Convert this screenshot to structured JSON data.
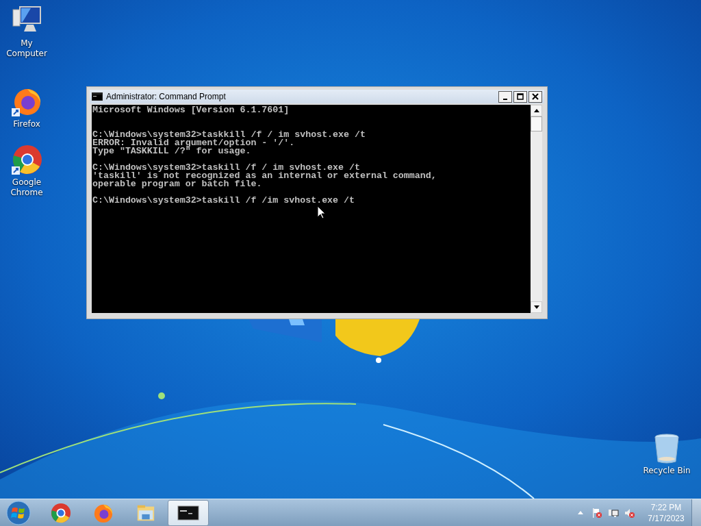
{
  "desktop_icons": [
    {
      "label": "My Computer",
      "kind": "computer"
    },
    {
      "label": "Firefox",
      "kind": "firefox"
    },
    {
      "label": "Google Chrome",
      "kind": "chrome"
    }
  ],
  "desktop_icons_right": [
    {
      "label": "Recycle Bin",
      "kind": "recycle"
    }
  ],
  "window": {
    "title": "Administrator:  Command Prompt",
    "blocks": [
      [
        "Microsoft Windows [Version 6.1.7601]"
      ],
      [
        "C:\\Windows\\system32>taskkill /f / im svhost.exe /t",
        "ERROR: Invalid argument/option - '/'.",
        "Type \"TASKKILL /?\" for usage."
      ],
      [
        "C:\\Windows\\system32>taskill /f / im svhost.exe /t",
        "'taskill' is not recognized as an internal or external command,",
        "operable program or batch file."
      ],
      [
        "C:\\Windows\\system32>taskill /f /im svhost.exe /t"
      ]
    ]
  },
  "taskbar": {
    "apps": [
      {
        "kind": "chrome",
        "selected": false
      },
      {
        "kind": "firefox",
        "selected": false
      },
      {
        "kind": "explorer",
        "selected": false
      },
      {
        "kind": "cmd",
        "selected": true
      }
    ],
    "clock": {
      "time": "7:22 PM",
      "date": "7/17/2023"
    }
  }
}
